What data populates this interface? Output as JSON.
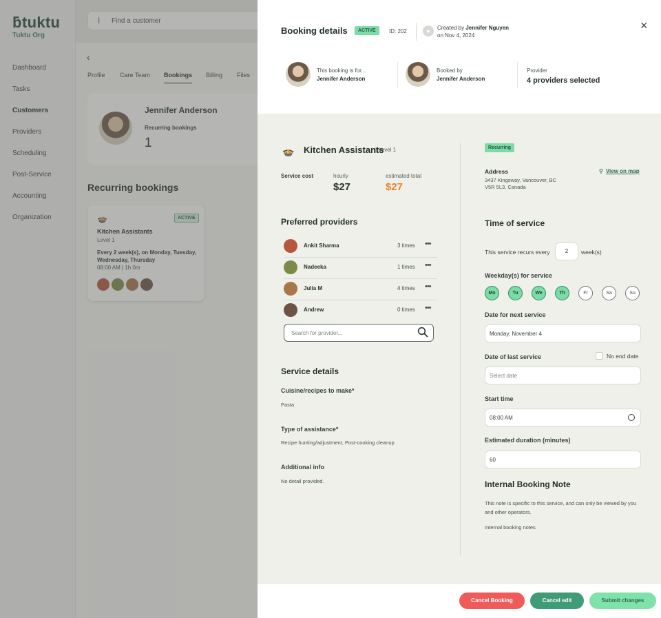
{
  "sidebar": {
    "brand": "tuktu",
    "org": "Tuktu Org",
    "items": [
      {
        "label": "Dashboard"
      },
      {
        "label": "Tasks"
      },
      {
        "label": "Customers"
      },
      {
        "label": "Providers"
      },
      {
        "label": "Scheduling"
      },
      {
        "label": "Post-Service"
      },
      {
        "label": "Accounting"
      },
      {
        "label": "Organization"
      }
    ],
    "active": "Customers"
  },
  "background": {
    "search_placeholder": "Find a customer",
    "back_glyph": "‹",
    "tabs": [
      "Profile",
      "Care Team",
      "Bookings",
      "Billing",
      "Files"
    ],
    "active_tab": "Bookings",
    "customer_name": "Jennifer Anderson",
    "recurring_label": "Recurring bookings",
    "recurring_count": "1",
    "section_title": "Recurring bookings",
    "card": {
      "badge": "ACTIVE",
      "title": "Kitchen Assistants",
      "level": "Level 1",
      "schedule": "Every 2 week(s), on Monday, Tuesday, Wednesday, Thursday",
      "time": "08:00 AM | 1h 0m"
    }
  },
  "drawer": {
    "title": "Booking details",
    "status": "ACTIVE",
    "id_text": "ID: 202",
    "created_prefix": "Created by ",
    "created_by": "Jennifer Nguyen",
    "created_on": "on Nov 4, 2024",
    "close_glyph": "×",
    "booking_for_label": "This booking is for...",
    "booking_for": "Jennifer Anderson",
    "booked_by_label": "Booked by",
    "booked_by": "Jennifer Anderson",
    "provider_label": "Provider",
    "provider_value": "4 providers selected",
    "service": {
      "title": "Kitchen Assistants",
      "level": "| Level 1",
      "cost_label": "Service cost",
      "hourly_label": "hourly",
      "hourly_value": "$27",
      "estimated_label": "estimated total",
      "estimated_value": "$27"
    },
    "preferred_title": "Preferred providers",
    "providers": [
      {
        "name": "Ankit Sharma",
        "times": "3 times"
      },
      {
        "name": "Nadeeka",
        "times": "1 times"
      },
      {
        "name": "Julia M",
        "times": "4 times"
      },
      {
        "name": "Andrew",
        "times": "0 times"
      }
    ],
    "provider_search_placeholder": "Search for provider...",
    "details_title": "Service details",
    "cuisine_label": "Cuisine/recipes to make*",
    "cuisine_value": "Pasta",
    "assistance_label": "Type of assistance*",
    "assistance_value": "Recipe hunting/adjustment, Post-cooking cleanup",
    "additional_label": "Additional info",
    "additional_value": "No detail provided.",
    "recurring_badge": "Recurring",
    "address_label": "Address",
    "address_line1": "3437 Kingsway, Vancouver, BC",
    "address_line2": "V5R 5L3, Canada",
    "map_link": "View on map",
    "time_title": "Time of service",
    "recurs_prefix": "This service recurs every",
    "recurs_value": "2",
    "recurs_unit": "week(s)",
    "weekday_label": "Weekday(s) for service",
    "weekdays": [
      {
        "label": "Mo",
        "selected": true
      },
      {
        "label": "Tu",
        "selected": true
      },
      {
        "label": "We",
        "selected": true
      },
      {
        "label": "Th",
        "selected": true
      },
      {
        "label": "Fr",
        "selected": false
      },
      {
        "label": "Sa",
        "selected": false
      },
      {
        "label": "Su",
        "selected": false
      }
    ],
    "next_label": "Date for next service",
    "next_value": "Monday, November 4",
    "last_label": "Date of last service",
    "no_end_label": "No end date",
    "last_placeholder": "Select date",
    "start_label": "Start time",
    "start_value": "08:00 AM",
    "duration_label": "Estimated duration (minutes)",
    "duration_value": "60",
    "note_title": "Internal Booking Note",
    "note_desc": "This note is specific to this service, and can only be viewed by you and other operators.",
    "note_placeholder": "Internal booking notes",
    "buttons": {
      "cancel_booking": "Cancel Booking",
      "cancel_edit": "Cancel edit",
      "submit": "Submit changes"
    }
  },
  "colors": {
    "accent_green": "#7ddba8",
    "danger": "#ef5b5b",
    "edit": "#3f9b78",
    "estimated": "#e9822d"
  }
}
